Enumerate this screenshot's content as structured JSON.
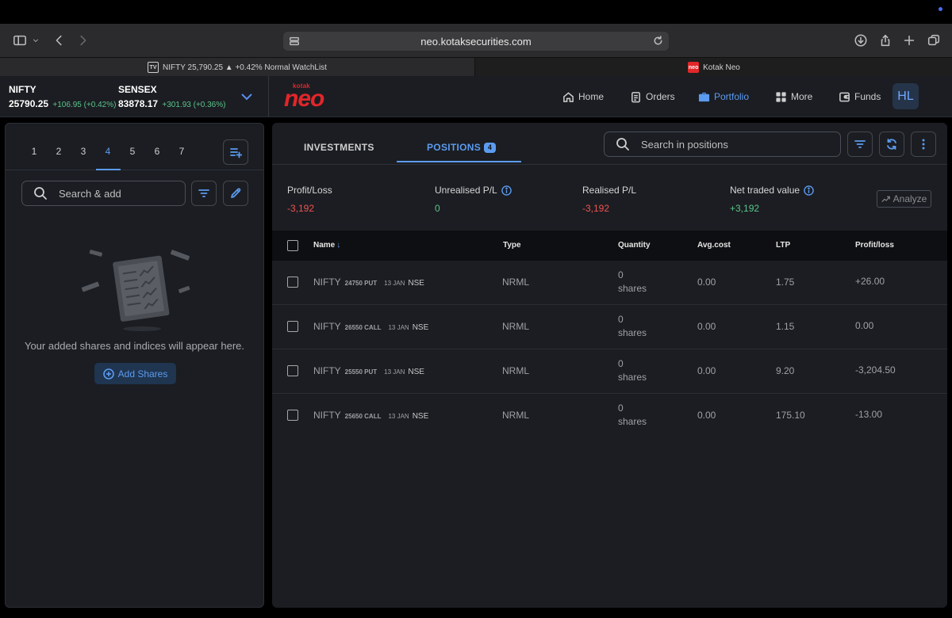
{
  "browser": {
    "url": "neo.kotaksecurities.com",
    "tabs": [
      {
        "favicon": "TV",
        "title": "NIFTY 25,790.25 ▲ +0.42% Normal WatchList"
      },
      {
        "favicon": "neo",
        "title": "Kotak Neo"
      }
    ]
  },
  "header": {
    "indices": [
      {
        "name": "NIFTY",
        "value": "25790.25",
        "change": "+106.95 (+0.42%)"
      },
      {
        "name": "SENSEX",
        "value": "83878.17",
        "change": "+301.93 (+0.36%)"
      }
    ],
    "logo": {
      "brand": "kotak",
      "product": "neo"
    },
    "nav": [
      {
        "label": "Home",
        "icon": "home-icon"
      },
      {
        "label": "Orders",
        "icon": "orders-icon"
      },
      {
        "label": "Portfolio",
        "icon": "briefcase-icon",
        "active": true
      },
      {
        "label": "More",
        "icon": "grid-icon"
      },
      {
        "label": "Funds",
        "icon": "wallet-icon"
      }
    ],
    "avatar": "HL"
  },
  "watchlist": {
    "tabs": [
      "1",
      "2",
      "3",
      "4",
      "5",
      "6",
      "7"
    ],
    "active_tab": "4",
    "search_placeholder": "Search & add",
    "empty_message": "Your added shares and indices will appear here.",
    "add_button": "Add Shares"
  },
  "positions": {
    "tabs": {
      "investments": "INVESTMENTS",
      "positions": "POSITIONS",
      "positions_count": "4"
    },
    "search_placeholder": "Search in positions",
    "summary": {
      "profit_loss": {
        "label": "Profit/Loss",
        "value": "-3,192"
      },
      "unrealised": {
        "label": "Unrealised P/L",
        "value": "0"
      },
      "realised": {
        "label": "Realised P/L",
        "value": "-3,192"
      },
      "net_traded": {
        "label": "Net traded value",
        "value": "+3,192"
      },
      "analyze": "Analyze"
    },
    "columns": {
      "name": "Name",
      "type": "Type",
      "quantity": "Quantity",
      "avg_cost": "Avg.cost",
      "ltp": "LTP",
      "profit_loss": "Profit/loss"
    },
    "rows": [
      {
        "symbol": "NIFTY",
        "strike": "24750 PUT",
        "expiry": "13 JAN",
        "exchange": "NSE",
        "type": "NRML",
        "qty": "0",
        "qty_unit": "shares",
        "avg_cost": "0.00",
        "ltp": "1.75",
        "pl": "+26.00"
      },
      {
        "symbol": "NIFTY",
        "strike": "26550 CALL",
        "expiry": "13 JAN",
        "exchange": "NSE",
        "type": "NRML",
        "qty": "0",
        "qty_unit": "shares",
        "avg_cost": "0.00",
        "ltp": "1.15",
        "pl": "0.00"
      },
      {
        "symbol": "NIFTY",
        "strike": "25550 PUT",
        "expiry": "13 JAN",
        "exchange": "NSE",
        "type": "NRML",
        "qty": "0",
        "qty_unit": "shares",
        "avg_cost": "0.00",
        "ltp": "9.20",
        "pl": "-3,204.50"
      },
      {
        "symbol": "NIFTY",
        "strike": "25650 CALL",
        "expiry": "13 JAN",
        "exchange": "NSE",
        "type": "NRML",
        "qty": "0",
        "qty_unit": "shares",
        "avg_cost": "0.00",
        "ltp": "175.10",
        "pl": "-13.00"
      }
    ]
  }
}
